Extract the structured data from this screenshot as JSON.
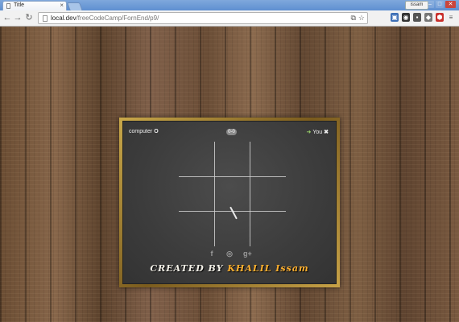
{
  "browser": {
    "tab_title": "Title",
    "tab_close": "×",
    "user": "issam",
    "window_min": "‒",
    "window_max": "□",
    "window_close": "✕",
    "url_host": "local.dev",
    "url_path": "/freeCodeCamp/FornEnd/p9/"
  },
  "game": {
    "computer_label": "computer",
    "computer_mark": "O",
    "score": "0-0",
    "you_label": "You",
    "you_mark": "✖"
  },
  "footer": {
    "credit_prefix": "CREATED BY",
    "credit_author": "KHALIL Issam"
  },
  "icons": {
    "social": [
      "facebook-icon",
      "github-icon",
      "google-plus-icon"
    ]
  }
}
